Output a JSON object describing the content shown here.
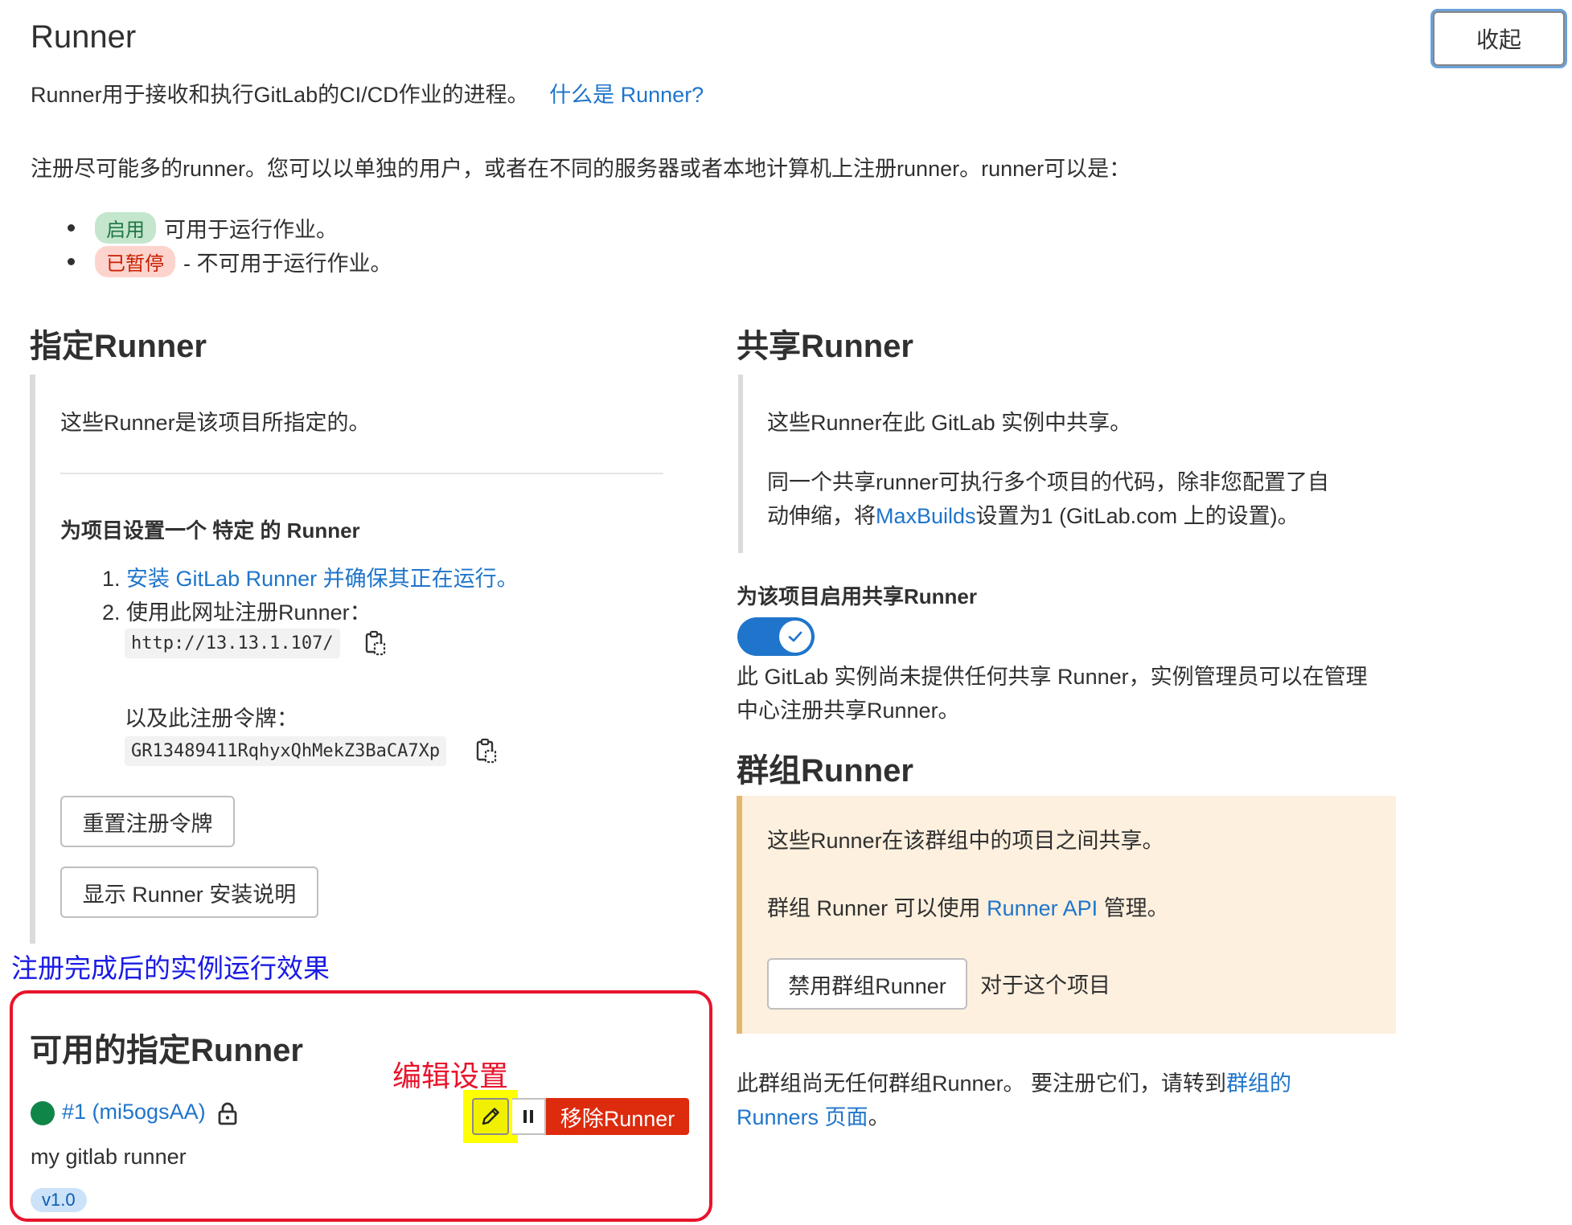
{
  "header": {
    "title": "Runner",
    "collapse_label": "收起",
    "intro_text": "Runner用于接收和执行GitLab的CI/CD作业的进程。",
    "intro_link": "什么是 Runner?",
    "register_note": "注册尽可能多的runner。您可以以单独的用户，或者在不同的服务器或者本地计算机上注册runner。runner可以是：",
    "states": [
      {
        "badge": "启用",
        "text": "可用于运行作业。"
      },
      {
        "badge": "已暂停",
        "text": "- 不可用于运行作业。"
      }
    ]
  },
  "specific": {
    "title": "指定Runner",
    "description": "这些Runner是该项目所指定的。",
    "setup_title": "为项目设置一个 特定 的 Runner",
    "step1_num": "1.",
    "step1_link": "安装 GitLab Runner 并确保其正在运行。",
    "step2_num": "2.",
    "step2_text": "使用此网址注册Runner：",
    "url": "http://13.13.1.107/",
    "token_label": "以及此注册令牌：",
    "token": "GR13489411RqhyxQhMekZ3BaCA7Xp",
    "reset_button": "重置注册令牌",
    "install_button": "显示 Runner 安装说明"
  },
  "shared": {
    "title": "共享Runner",
    "description": "这些Runner在此 GitLab 实例中共享。",
    "note_line1": "同一个共享runner可执行多个项目的代码，除非您配置了自",
    "note_line2_pre": "动伸缩，将",
    "note_link": "MaxBuilds",
    "note_line2_post": "设置为1 (GitLab.com 上的设置)。",
    "toggle_label": "为该项目启用共享Runner",
    "toggle_on": true,
    "empty_line1": "此 GitLab 实例尚未提供任何共享 Runner，实例管理员可以在管理",
    "empty_line2": "中心注册共享Runner。"
  },
  "group": {
    "title": "群组Runner",
    "description": "这些Runner在该群组中的项目之间共享。",
    "api_pre": "群组 Runner 可以使用",
    "api_link": "Runner API",
    "api_post": "管理。",
    "disable_button": "禁用群组Runner",
    "disable_suffix": "对于这个项目",
    "empty_pre": "此群组尚无任何群组Runner。 要注册它们，请转到",
    "empty_link1": "群组的",
    "empty_link2": "Runners 页面",
    "empty_post": "。"
  },
  "annotations": {
    "instance_caption": "注册完成后的实例运行效果",
    "edit_caption": "编辑设置"
  },
  "available": {
    "title": "可用的指定Runner",
    "runner_link": "#1 (mi5ogsAA)",
    "runner_description": "my gitlab runner",
    "remove_button": "移除Runner",
    "version": "v1.0",
    "status_color": "#108548",
    "icons": [
      "lock-icon",
      "pencil-icon",
      "pause-icon"
    ]
  }
}
